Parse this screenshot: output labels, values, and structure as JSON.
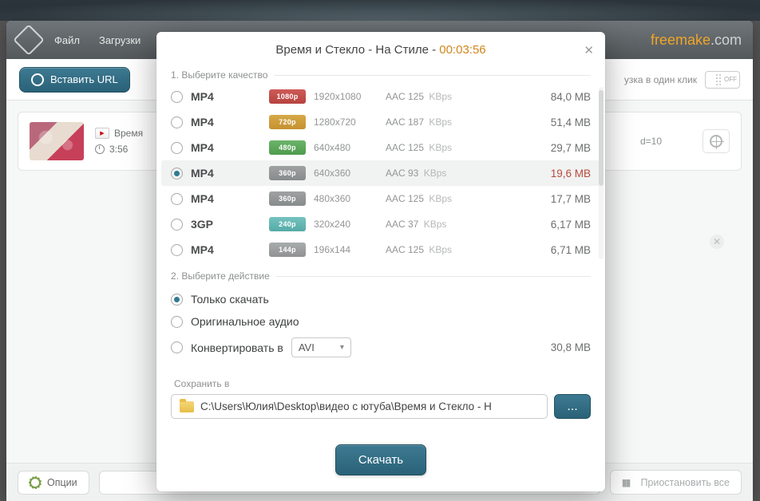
{
  "window": {
    "menu": {
      "file": "Файл",
      "downloads": "Загрузки"
    },
    "brand1": "freemake",
    "brand2": ".com",
    "paste_url": "Вставить URL",
    "oneclick": "узка в один клик",
    "toggle": "OFF"
  },
  "item": {
    "title": "Время",
    "duration": "3:56",
    "url_tail": "d=10"
  },
  "footer": {
    "options": "Опции",
    "pause_all": "Приостановить все"
  },
  "modal": {
    "title_main": "Время и Стекло - На Стиле - ",
    "title_dur": "00:03:56",
    "section1": "1. Выберите качество",
    "section2": "2. Выберите действие",
    "qualities": [
      {
        "fmt": "MP4",
        "badge": "1080p",
        "bclass": "b-1080",
        "res": "1920x1080",
        "aac": "AAC 125",
        "kbps": "KBps",
        "size": "84,0 MB",
        "apple": false,
        "on": false
      },
      {
        "fmt": "MP4",
        "badge": "720p",
        "bclass": "b-720",
        "res": "1280x720",
        "aac": "AAC 187",
        "kbps": "KBps",
        "size": "51,4 MB",
        "apple": false,
        "on": false
      },
      {
        "fmt": "MP4",
        "badge": "480p",
        "bclass": "b-480",
        "res": "640x480",
        "aac": "AAC 125",
        "kbps": "KBps",
        "size": "29,7 MB",
        "apple": false,
        "on": false
      },
      {
        "fmt": "MP4",
        "badge": "360p",
        "bclass": "b-360",
        "res": "640x360",
        "aac": "AAC 93",
        "kbps": "KBps",
        "size": "19,6 MB",
        "apple": true,
        "on": true
      },
      {
        "fmt": "MP4",
        "badge": "360p",
        "bclass": "b-360",
        "res": "480x360",
        "aac": "AAC 125",
        "kbps": "KBps",
        "size": "17,7 MB",
        "apple": false,
        "on": false
      },
      {
        "fmt": "3GP",
        "badge": "240p",
        "bclass": "b-240",
        "res": "320x240",
        "aac": "AAC 37",
        "kbps": "KBps",
        "size": "6,17 MB",
        "apple": false,
        "on": false
      },
      {
        "fmt": "MP4",
        "badge": "144p",
        "bclass": "b-144",
        "res": "196x144",
        "aac": "AAC 125",
        "kbps": "KBps",
        "size": "6,71 MB",
        "apple": false,
        "on": false
      }
    ],
    "actions": {
      "download_only": "Только скачать",
      "original_audio": "Оригинальное аудио",
      "convert_to": "Конвертировать в",
      "convert_format": "AVI",
      "convert_size": "30,8 MB"
    },
    "save": {
      "label": "Сохранить в",
      "path": "C:\\Users\\Юлия\\Desktop\\видео с ютуба\\Время и Стекло - Н",
      "browse": "..."
    },
    "download_btn": "Скачать"
  }
}
